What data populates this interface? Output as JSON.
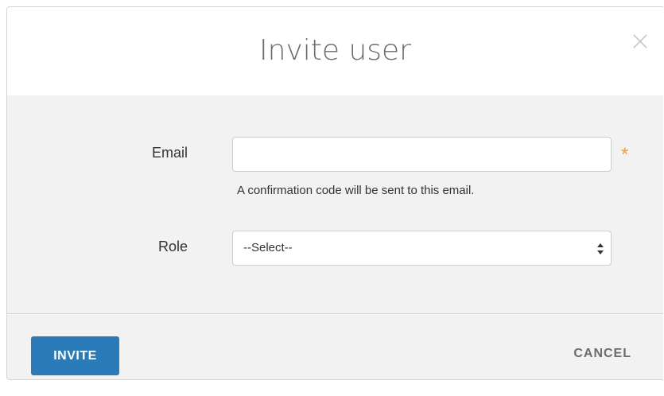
{
  "dialog": {
    "title": "Invite user",
    "close_icon": "close-icon"
  },
  "form": {
    "email": {
      "label": "Email",
      "value": "",
      "placeholder": "",
      "required_marker": "*",
      "help_text": "A confirmation code will be sent to this email."
    },
    "role": {
      "label": "Role",
      "selected": "--Select--",
      "arrow_icon": "select-arrows-icon"
    }
  },
  "actions": {
    "invite_label": "INVITE",
    "cancel_label": "CANCEL"
  },
  "colors": {
    "primary": "#2b7bb9",
    "required": "#f0a030",
    "body_background": "#f2f2f2"
  }
}
